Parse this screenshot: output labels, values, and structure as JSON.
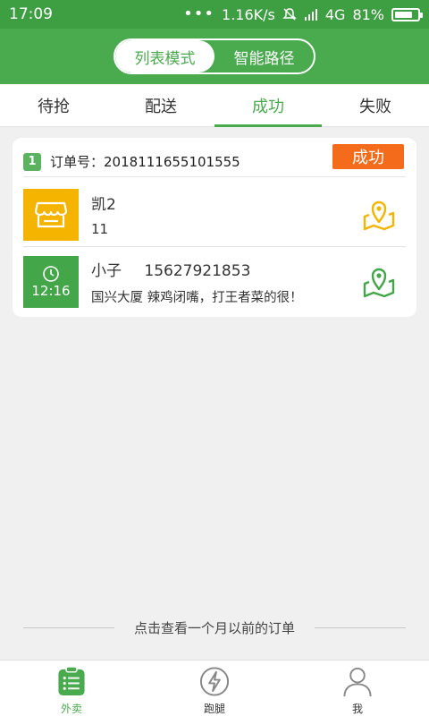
{
  "status_bar": {
    "time": "17:09",
    "dots": "•••",
    "network_speed": "1.16K/s",
    "signal": "4G",
    "battery": "81%",
    "battery_level": 0.81
  },
  "header": {
    "modes": [
      {
        "label": "列表模式",
        "active": true
      },
      {
        "label": "智能路径",
        "active": false
      }
    ]
  },
  "tabs": [
    {
      "label": "待抢",
      "active": false
    },
    {
      "label": "配送",
      "active": false
    },
    {
      "label": "成功",
      "active": true
    },
    {
      "label": "失败",
      "active": false
    }
  ],
  "order": {
    "index": "1",
    "number_label": "订单号：",
    "number": "2018111655101555",
    "status": "成功",
    "shop": {
      "name": "凯2",
      "detail": "11",
      "icon": "store-icon",
      "map_icon": "map-pin-icon"
    },
    "customer": {
      "time": "12:16",
      "name": "小子",
      "phone": "15627921853",
      "address": "国兴大厦 辣鸡闭嘴，打王者菜的很！",
      "icon": "clock-icon",
      "map_icon": "map-pin-icon"
    }
  },
  "history_link": "点击查看一个月以前的订单",
  "bottom_nav": [
    {
      "label": "外卖",
      "icon": "list-icon",
      "active": true
    },
    {
      "label": "跑腿",
      "icon": "lightning-icon",
      "active": false
    },
    {
      "label": "我",
      "icon": "user-icon",
      "active": false
    }
  ],
  "colors": {
    "primary": "#4aaa4e",
    "status_bar": "#3e9e42",
    "success_badge": "#f46b1c",
    "shop_thumb": "#f5b400",
    "background": "#f0f0f0"
  }
}
